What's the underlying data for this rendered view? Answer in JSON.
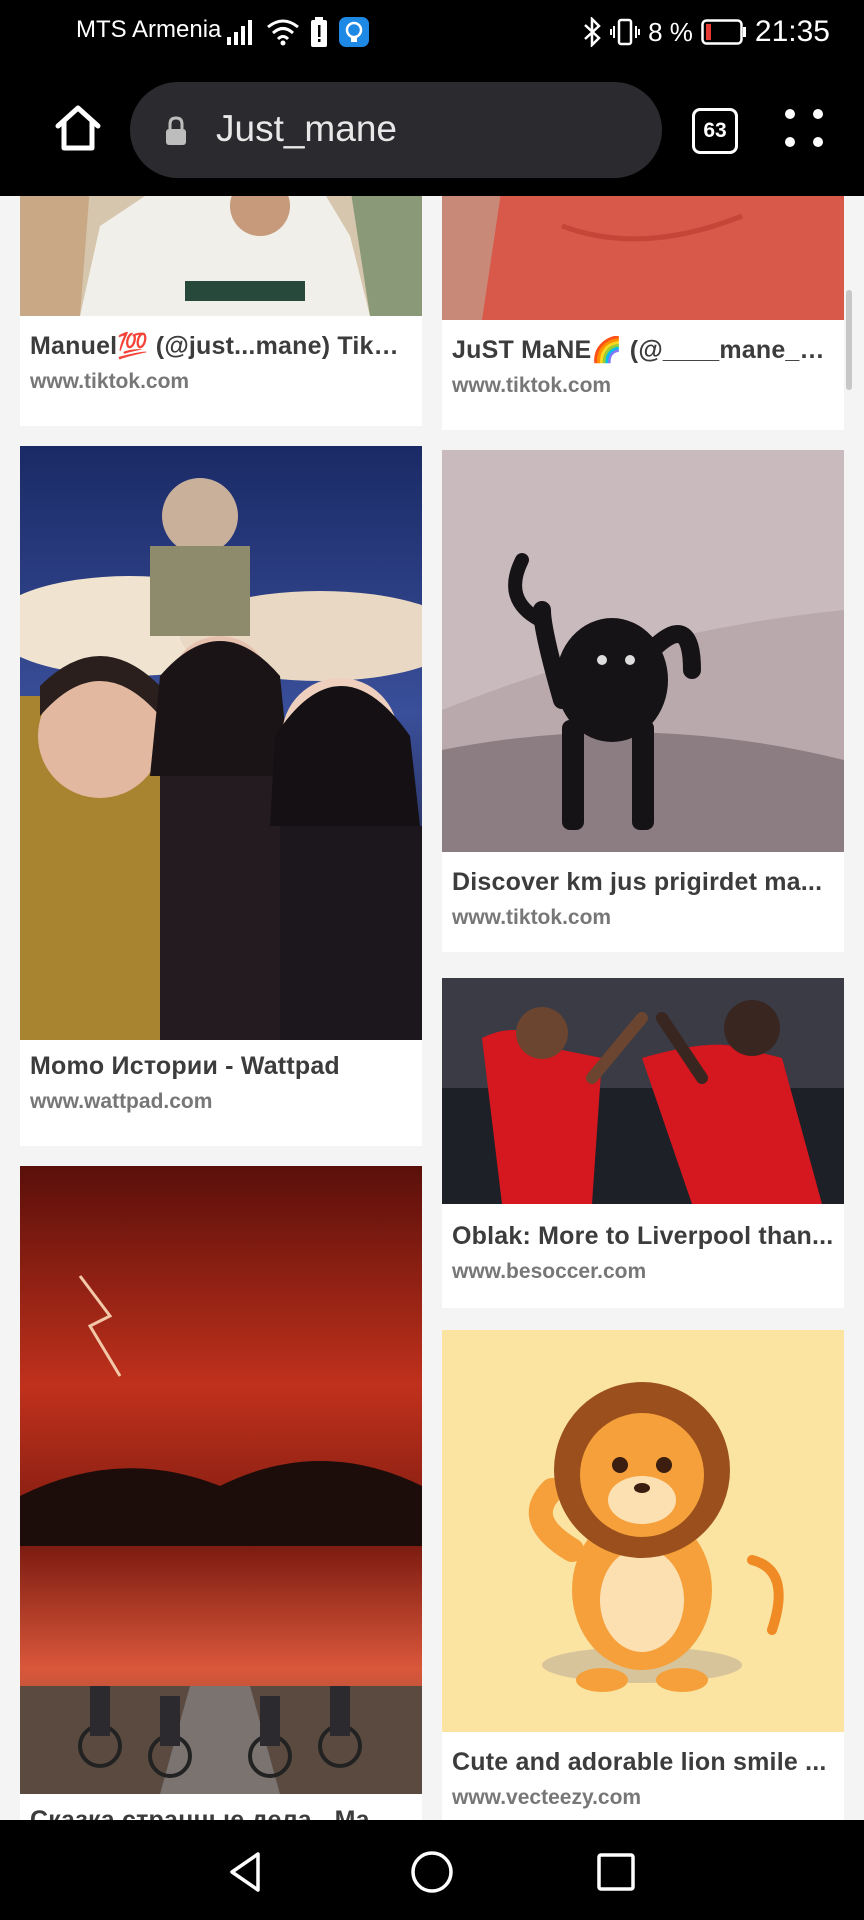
{
  "status_bar": {
    "carrier": "MTS Armenia",
    "battery_percent": "8 %",
    "time": "21:35"
  },
  "toolbar": {
    "url_text": "Just_mane",
    "tab_count": "63"
  },
  "results": [
    {
      "caption": "Manuel💯 (@just...mane) TikTok...",
      "source": "www.tiktok.com",
      "image": "photo-person-shirt"
    },
    {
      "caption": "JuST MaNE🌈 (@____mane__...",
      "source": "www.tiktok.com",
      "image": "photo-red-shirt"
    },
    {
      "caption": "Momo Истории - Wattpad",
      "source": "www.wattpad.com",
      "image": "kpop-poster"
    },
    {
      "caption": "Discover km jus prigirdet ma...",
      "source": "www.tiktok.com",
      "image": "black-cat-meme"
    },
    {
      "caption": "Oblak: More to Liverpool than...",
      "source": "www.besoccer.com",
      "image": "football-players"
    },
    {
      "caption": "Сказка странные дела - Ma...",
      "source": "",
      "image": "red-storm-bikes"
    },
    {
      "caption": "Cute and adorable lion smile ...",
      "source": "www.vecteezy.com",
      "image": "cartoon-lion"
    }
  ],
  "icons": {
    "home": "home-icon",
    "lock": "lock-icon",
    "menu": "more-vert-icon",
    "back": "back-triangle-icon",
    "home_nav": "home-circle-icon",
    "recents": "recents-square-icon"
  },
  "colors": {
    "chrome_bg": "#000000",
    "urlbar_bg": "#2b2b2f",
    "battery_low": "#e53935",
    "vpn_blue": "#1e88e5",
    "page_bg": "#f4f4f4"
  }
}
